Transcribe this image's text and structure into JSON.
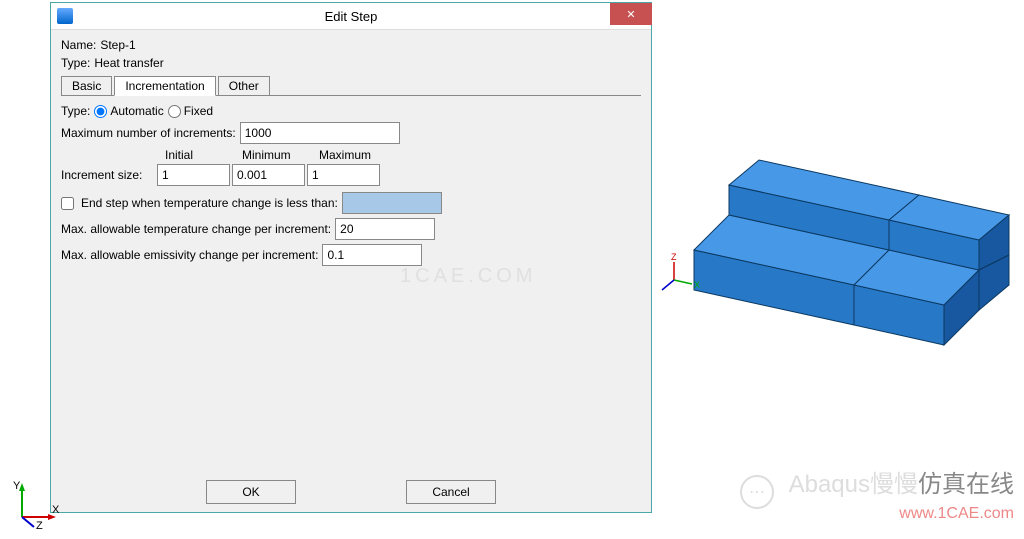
{
  "dialog": {
    "title": "Edit Step",
    "name_label": "Name:",
    "name_value": "Step-1",
    "type_label": "Type:",
    "type_value": "Heat transfer",
    "tabs": {
      "basic": "Basic",
      "incrementation": "Incrementation",
      "other": "Other"
    },
    "inc": {
      "type_label": "Type:",
      "automatic": "Automatic",
      "fixed": "Fixed",
      "max_inc_label": "Maximum number of increments:",
      "max_inc_value": "1000",
      "headers": {
        "initial": "Initial",
        "minimum": "Minimum",
        "maximum": "Maximum"
      },
      "inc_size_label": "Increment size:",
      "initial": "1",
      "minimum": "0.001",
      "maximum": "1",
      "end_step_label": "End step when temperature change is less than:",
      "end_step_value": "",
      "max_temp_label": "Max. allowable temperature change per increment:",
      "max_temp_value": "20",
      "max_emis_label": "Max. allowable emissivity change per increment:",
      "max_emis_value": "0.1"
    },
    "buttons": {
      "ok": "OK",
      "cancel": "Cancel"
    }
  },
  "axes": {
    "x": "X",
    "y": "Y",
    "z": "Z"
  },
  "watermark": {
    "text1": "Abaqus慢慢",
    "text2": "仿真在线",
    "url": "www.1CAE.com",
    "center": "1CAE.COM"
  }
}
